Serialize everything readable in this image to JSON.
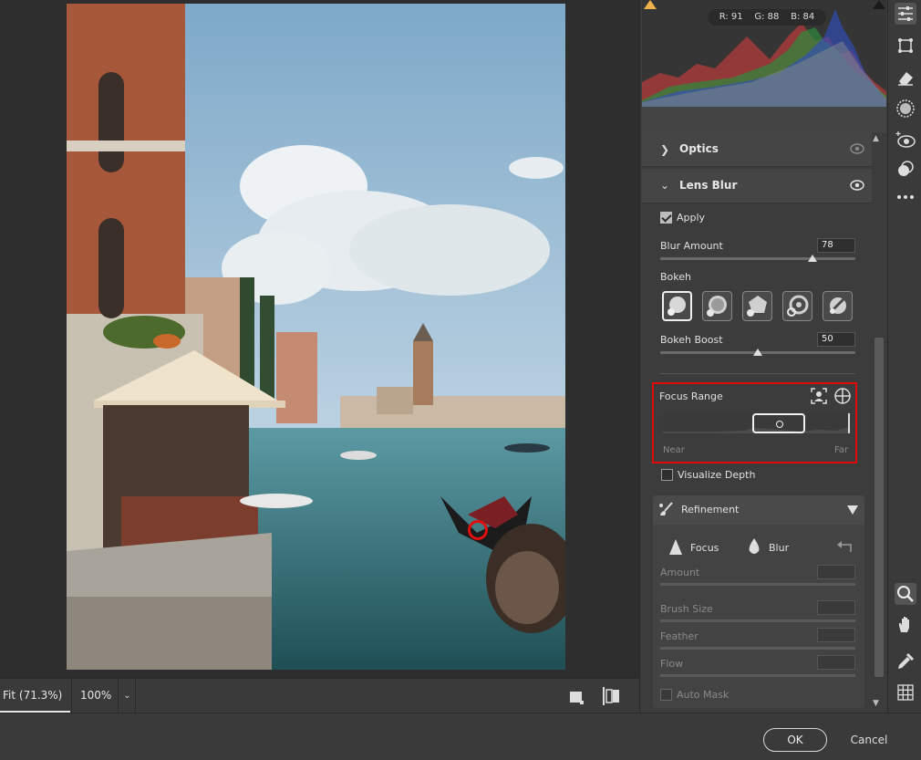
{
  "histogram": {
    "r_label": "R: 91",
    "g_label": "G: 88",
    "b_label": "B: 84"
  },
  "optics": {
    "title": "Optics"
  },
  "lens_blur": {
    "title": "Lens Blur",
    "apply_label": "Apply",
    "apply_checked": true,
    "blur_amount_label": "Blur Amount",
    "blur_amount_value": "78",
    "bokeh_label": "Bokeh",
    "bokeh_boost_label": "Bokeh Boost",
    "bokeh_boost_value": "50",
    "focus_range_label": "Focus Range",
    "near_label": "Near",
    "far_label": "Far",
    "visualize_depth_label": "Visualize Depth"
  },
  "refinement": {
    "title": "Refinement",
    "focus_label": "Focus",
    "blur_label": "Blur",
    "amount_label": "Amount",
    "brush_size_label": "Brush Size",
    "feather_label": "Feather",
    "flow_label": "Flow",
    "auto_mask_label": "Auto Mask"
  },
  "zoom": {
    "fit_label": "Fit (71.3%)",
    "hundred_label": "100%"
  },
  "footer": {
    "ok_label": "OK",
    "cancel_label": "Cancel"
  },
  "colors": {
    "highlight_red": "#e00a0a",
    "panel_bg": "#3c3c3c"
  }
}
